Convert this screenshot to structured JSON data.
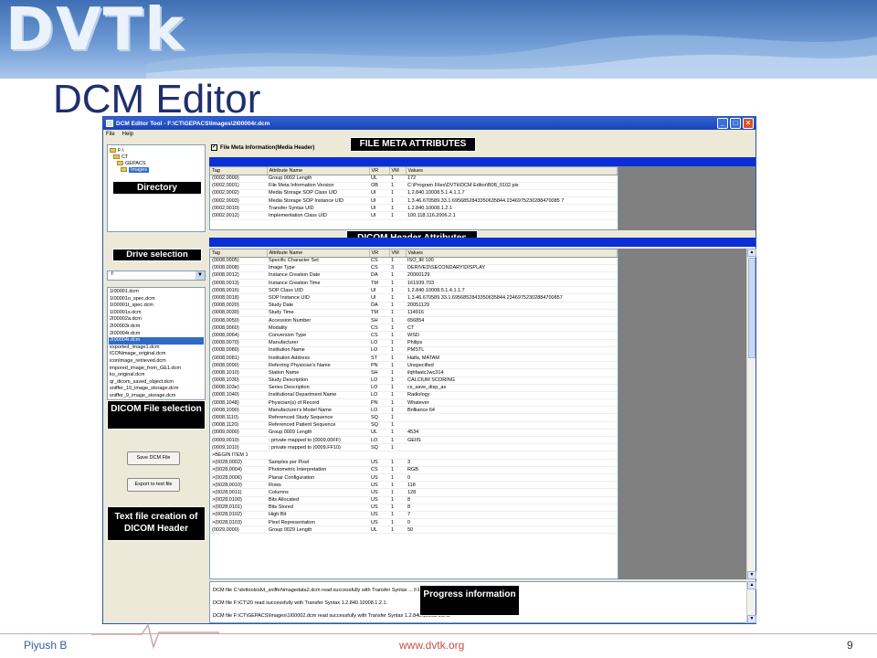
{
  "slide": {
    "logo": "DVTk",
    "title": "DCM Editor",
    "footer_left": "Piyush B",
    "footer_mid": "www.dvtk.org",
    "page_number": "9"
  },
  "window": {
    "title": "DCM Editor Tool - F:\\CT\\GEPACS\\Images\\2I00004r.dcm",
    "menu": [
      "File",
      "Help"
    ]
  },
  "directory_tree": [
    {
      "label": "F:\\",
      "level": 0
    },
    {
      "label": "CT",
      "level": 1
    },
    {
      "label": "GEPACS",
      "level": 2
    },
    {
      "label": "Images",
      "level": 3
    }
  ],
  "drive": {
    "value": "f:"
  },
  "files": [
    "1I00001.dcm",
    "1I00001o_spec.dcm",
    "1I00001t_spec.dcm",
    "1I00001s.dcm",
    "2I00002a.dcm",
    "2I00003r.dcm",
    "2I00004r.dcm",
    "2I00004r.dcm",
    "exported_image1.dcm",
    "ICONimage_original.dcm",
    "iconImage_retrieved.dcm",
    "impored_image_from_GE1.dcm",
    "ko_original.dcm",
    "qr_dicom_saved_object.dcm",
    "sniffer_10_image_storage.dcm",
    "sniffer_9_image_storage.dcm"
  ],
  "selected_file_index": 7,
  "buttons": {
    "save": "Save DCM File",
    "export": "Export to text file"
  },
  "callouts": {
    "directory": "Directory",
    "drive": "Drive selection",
    "file_selection": "DICOM File selection",
    "text_file": "Text file creation of DICOM Header",
    "meta_attrs": "FILE META ATTRIBUTES",
    "header_attrs": "DICOM Header Attributes",
    "progress": "Progress information"
  },
  "checkbox": {
    "label": "File Meta Information(Media Header)",
    "checked": true
  },
  "columns": [
    "Tag",
    "Attribute Name",
    "VR",
    "VM",
    "Values"
  ],
  "meta_rows": [
    [
      "(0002,0000)",
      "Group 0002 Length",
      "UL",
      "1",
      "172"
    ],
    [
      "(0002,0001)",
      "File Meta Information Version",
      "OB",
      "1",
      "C:\\Program Files\\DVTk\\DCM Editor\\B08_0102.pix"
    ],
    [
      "(0002,0002)",
      "Media Storage SOP Class UID",
      "UI",
      "1",
      "1.2.840.10008.5.1.4.1.1.7"
    ],
    [
      "(0002,0003)",
      "Media Storage SOP Instance UID",
      "UI",
      "1",
      "1.3.46.670589.33.1.6956852843350635844.2346975230288470085 7"
    ],
    [
      "(0002,0010)",
      "Transfer Syntax UID",
      "UI",
      "1",
      "1.2.840.10008.1.2.1"
    ],
    [
      "(0002,0012)",
      "Implementation Class UID",
      "UI",
      "1",
      "100.118.116.2006.2.1"
    ]
  ],
  "header_rows": [
    [
      "(0008,0005)",
      "Specific Character Set",
      "CS",
      "1",
      "ISO_IR 100"
    ],
    [
      "(0008,0008)",
      "Image Type",
      "CS",
      "3",
      "DERIVED\\SECONDARY\\DISPLAY"
    ],
    [
      "(0008,0012)",
      "Instance Creation Date",
      "DA",
      "1",
      "20060129"
    ],
    [
      "(0008,0013)",
      "Instance Creation Time",
      "TM",
      "1",
      "161939.703"
    ],
    [
      "(0008,0016)",
      "SOP Class UID",
      "UI",
      "1",
      "1.2.840.10008.5.1.4.1.1.7"
    ],
    [
      "(0008,0018)",
      "SOP Instance UID",
      "UI",
      "1",
      "1.3.46.670589.33.1.6956852843350635844.23469752302884700857"
    ],
    [
      "(0008,0020)",
      "Study Date",
      "DA",
      "1",
      "20051129"
    ],
    [
      "(0008,0030)",
      "Study Time",
      "TM",
      "1",
      "114916"
    ],
    [
      "(0008,0050)",
      "Accession Number",
      "SH",
      "1",
      "656854"
    ],
    [
      "(0008,0060)",
      "Modality",
      "CS",
      "1",
      "CT"
    ],
    [
      "(0008,0064)",
      "Conversion Type",
      "CS",
      "1",
      "WSD"
    ],
    [
      "(0008,0070)",
      "Manufacturer",
      "LO",
      "1",
      "Philips"
    ],
    [
      "(0008,0080)",
      "Institution Name",
      "LO",
      "1",
      "PMSTL"
    ],
    [
      "(0008,0081)",
      "Institution Address",
      "ST",
      "1",
      "Haifa, MATAM"
    ],
    [
      "(0008,0090)",
      "Referring Physician's Name",
      "PN",
      "1",
      "Unspecified"
    ],
    [
      "(0008,1010)",
      "Station Name",
      "SH",
      "1",
      "ilqhfaatc1wc314"
    ],
    [
      "(0008,1030)",
      "Study Description",
      "LO",
      "1",
      "CALCIUM SCORING"
    ],
    [
      "(0008,103e)",
      "Series Description",
      "LO",
      "1",
      "cs_save_disp_as"
    ],
    [
      "(0008,1040)",
      "Institutional Department Name",
      "LO",
      "1",
      "Radiology"
    ],
    [
      "(0008,1048)",
      "Physician(s) of Record",
      "PN",
      "1",
      "Whatever"
    ],
    [
      "(0008,1090)",
      "Manufacturer's Model Name",
      "LO",
      "1",
      "Brilliance 64"
    ],
    [
      "(0008,1110)",
      "Referenced Study Sequence",
      "SQ",
      "1",
      ""
    ],
    [
      "(0008,1120)",
      "Referenced Patient Sequence",
      "SQ",
      "1",
      ""
    ],
    [
      "(0009,0000)",
      "Group 0009 Length",
      "UL",
      "1",
      "4534"
    ],
    [
      "(0009,0010)",
      "  : private mapped to (0009,00FF)",
      "LO",
      "1",
      "GEIIS"
    ],
    [
      "(0009,1010)",
      "  : private mapped to (0009,FF10)",
      "SQ",
      "1",
      ""
    ],
    [
      ">BEGIN ITEM 1",
      "",
      "",
      "",
      ""
    ],
    [
      ">(0028,0002)",
      "Samples per Pixel",
      "US",
      "1",
      "3"
    ],
    [
      ">(0028,0004)",
      "Photometric Interpretation",
      "CS",
      "1",
      "RGB"
    ],
    [
      ">(0028,0006)",
      "Planar Configuration",
      "US",
      "1",
      "0"
    ],
    [
      ">(0028,0010)",
      "Rows",
      "US",
      "1",
      "118"
    ],
    [
      ">(0028,0011)",
      "Columns",
      "US",
      "1",
      "128"
    ],
    [
      ">(0028,0100)",
      "Bits Allocated",
      "US",
      "1",
      "8"
    ],
    [
      ">(0028,0101)",
      "Bits Stored",
      "US",
      "1",
      "8"
    ],
    [
      ">(0028,0102)",
      "High Bit",
      "US",
      "1",
      "7"
    ],
    [
      ">(0028,0103)",
      "Pixel Representation",
      "US",
      "1",
      "0"
    ],
    [
      "(0029,0000)",
      "Group 0029 Length",
      "UL",
      "1",
      "50"
    ]
  ],
  "log_lines": [
    "DCM file C:\\dvttools\\dvt_sniffer\\imagedata2.dcm read successfully with Transfer Syntax ... ll Explicit VR Little Endian.",
    "DCM file F:\\CT\\20 read successfully with Transfer Syntax 1.2.840.10008.1.2.1.",
    "DCM file F:\\CT\\GEPACS\\Images\\1I00002.dcm read successfully with Transfer Syntax 1.2.840.10008.1.2.1."
  ]
}
